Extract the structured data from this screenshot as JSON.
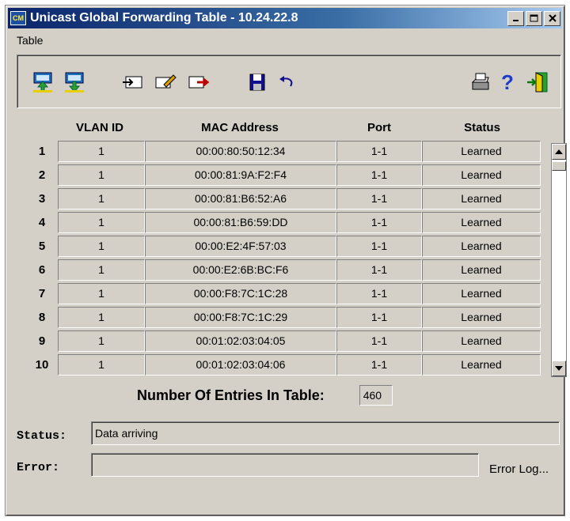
{
  "window": {
    "title": "Unicast Global Forwarding Table - 10.24.22.8",
    "app_icon_text": "CM"
  },
  "menu": {
    "items": [
      "Table"
    ]
  },
  "toolbar": {
    "icons": [
      "upload-icon",
      "download-icon",
      "insert-row-icon",
      "edit-icon",
      "export-icon",
      "save-icon",
      "undo-icon",
      "print-icon",
      "help-icon",
      "exit-icon"
    ],
    "help_glyph": "?"
  },
  "table": {
    "headers": [
      "VLAN ID",
      "MAC Address",
      "Port",
      "Status"
    ],
    "rows": [
      {
        "num": "1",
        "vlan": "1",
        "mac": "00:00:80:50:12:34",
        "port": "1-1",
        "status": "Learned"
      },
      {
        "num": "2",
        "vlan": "1",
        "mac": "00:00:81:9A:F2:F4",
        "port": "1-1",
        "status": "Learned"
      },
      {
        "num": "3",
        "vlan": "1",
        "mac": "00:00:81:B6:52:A6",
        "port": "1-1",
        "status": "Learned"
      },
      {
        "num": "4",
        "vlan": "1",
        "mac": "00:00:81:B6:59:DD",
        "port": "1-1",
        "status": "Learned"
      },
      {
        "num": "5",
        "vlan": "1",
        "mac": "00:00:E2:4F:57:03",
        "port": "1-1",
        "status": "Learned"
      },
      {
        "num": "6",
        "vlan": "1",
        "mac": "00:00:E2:6B:BC:F6",
        "port": "1-1",
        "status": "Learned"
      },
      {
        "num": "7",
        "vlan": "1",
        "mac": "00:00:F8:7C:1C:28",
        "port": "1-1",
        "status": "Learned"
      },
      {
        "num": "8",
        "vlan": "1",
        "mac": "00:00:F8:7C:1C:29",
        "port": "1-1",
        "status": "Learned"
      },
      {
        "num": "9",
        "vlan": "1",
        "mac": "00:01:02:03:04:05",
        "port": "1-1",
        "status": "Learned"
      },
      {
        "num": "10",
        "vlan": "1",
        "mac": "00:01:02:03:04:06",
        "port": "1-1",
        "status": "Learned"
      }
    ]
  },
  "entries": {
    "label": "Number Of Entries In Table:",
    "value": "460"
  },
  "status": {
    "label": "Status:",
    "value": "Data arriving"
  },
  "error": {
    "label": "Error:",
    "value": "",
    "log_button": "Error Log..."
  },
  "colors": {
    "title_start": "#0a246a",
    "title_end": "#a6caf0",
    "face": "#d4d0c8"
  }
}
